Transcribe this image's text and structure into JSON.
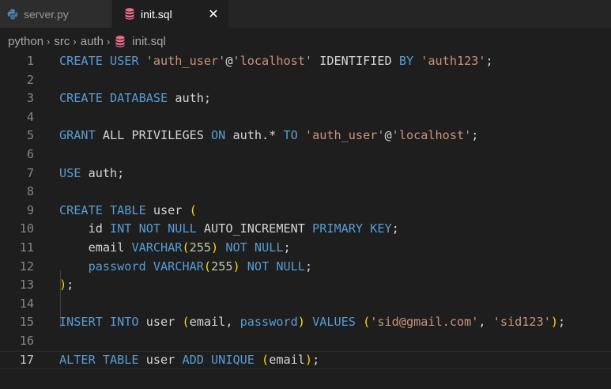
{
  "tabs": [
    {
      "label": "server.py",
      "icon": "python-icon",
      "active": false
    },
    {
      "label": "init.sql",
      "icon": "database-icon",
      "active": true,
      "close": "✕"
    }
  ],
  "breadcrumb": {
    "parts": [
      "python",
      "src",
      "auth"
    ],
    "file": "init.sql",
    "separator": "›"
  },
  "colors": {
    "keyword": "#569cd6",
    "string": "#ce9178",
    "number": "#b5cea8",
    "bracket": "#ffd700",
    "db_icon": "#f06b8a",
    "python_icon": "#4b8bbe"
  },
  "editor": {
    "active_line": 17,
    "lines": [
      {
        "n": "1",
        "tokens": [
          [
            "kw",
            "CREATE USER "
          ],
          [
            "str",
            "'auth_user'"
          ],
          [
            "id",
            "@"
          ],
          [
            "str",
            "'localhost'"
          ],
          [
            "id",
            " IDENTIFIED "
          ],
          [
            "kw",
            "BY "
          ],
          [
            "str",
            "'auth123'"
          ],
          [
            "id",
            ";"
          ]
        ]
      },
      {
        "n": "2",
        "tokens": []
      },
      {
        "n": "3",
        "tokens": [
          [
            "kw",
            "CREATE DATABASE "
          ],
          [
            "id",
            "auth;"
          ]
        ]
      },
      {
        "n": "4",
        "tokens": []
      },
      {
        "n": "5",
        "tokens": [
          [
            "kw",
            "GRANT "
          ],
          [
            "id",
            "ALL PRIVILEGES "
          ],
          [
            "kw",
            "ON "
          ],
          [
            "id",
            "auth.* "
          ],
          [
            "kw",
            "TO "
          ],
          [
            "str",
            "'auth_user'"
          ],
          [
            "id",
            "@"
          ],
          [
            "str",
            "'localhost'"
          ],
          [
            "id",
            ";"
          ]
        ]
      },
      {
        "n": "6",
        "tokens": []
      },
      {
        "n": "7",
        "tokens": [
          [
            "kw",
            "USE "
          ],
          [
            "id",
            "auth;"
          ]
        ]
      },
      {
        "n": "8",
        "tokens": []
      },
      {
        "n": "9",
        "tokens": [
          [
            "kw",
            "CREATE TABLE "
          ],
          [
            "id",
            "user "
          ],
          [
            "par",
            "("
          ]
        ]
      },
      {
        "n": "10",
        "tokens": [
          [
            "id",
            "    id "
          ],
          [
            "kw",
            "INT NOT NULL "
          ],
          [
            "id",
            "AUTO_INCREMENT "
          ],
          [
            "kw",
            "PRIMARY KEY"
          ],
          [
            "id",
            ";"
          ]
        ]
      },
      {
        "n": "11",
        "tokens": [
          [
            "id",
            "    email "
          ],
          [
            "kw",
            "VARCHAR"
          ],
          [
            "par",
            "("
          ],
          [
            "num",
            "255"
          ],
          [
            "par",
            ")"
          ],
          [
            "kw",
            " NOT NULL"
          ],
          [
            "id",
            ";"
          ]
        ]
      },
      {
        "n": "12",
        "tokens": [
          [
            "id",
            "    "
          ],
          [
            "kw",
            "password VARCHAR"
          ],
          [
            "par",
            "("
          ],
          [
            "num",
            "255"
          ],
          [
            "par",
            ")"
          ],
          [
            "kw",
            " NOT NULL"
          ],
          [
            "id",
            ";"
          ]
        ]
      },
      {
        "n": "13",
        "tokens": [
          [
            "par",
            ")"
          ],
          [
            "id",
            ";"
          ]
        ]
      },
      {
        "n": "14",
        "tokens": []
      },
      {
        "n": "15",
        "tokens": [
          [
            "kw",
            "INSERT INTO "
          ],
          [
            "id",
            "user "
          ],
          [
            "par",
            "("
          ],
          [
            "id",
            "email, "
          ],
          [
            "kw",
            "password"
          ],
          [
            "par",
            ")"
          ],
          [
            "kw",
            " VALUES "
          ],
          [
            "par",
            "("
          ],
          [
            "str",
            "'sid@gmail.com'"
          ],
          [
            "id",
            ", "
          ],
          [
            "str",
            "'sid123'"
          ],
          [
            "par",
            ")"
          ],
          [
            "id",
            ";"
          ]
        ]
      },
      {
        "n": "16",
        "tokens": []
      },
      {
        "n": "17",
        "tokens": [
          [
            "kw",
            "ALTER TABLE "
          ],
          [
            "id",
            "user "
          ],
          [
            "kw",
            "ADD UNIQUE "
          ],
          [
            "par",
            "("
          ],
          [
            "id",
            "email"
          ],
          [
            "par",
            ")"
          ],
          [
            "id",
            ";"
          ]
        ]
      }
    ]
  }
}
